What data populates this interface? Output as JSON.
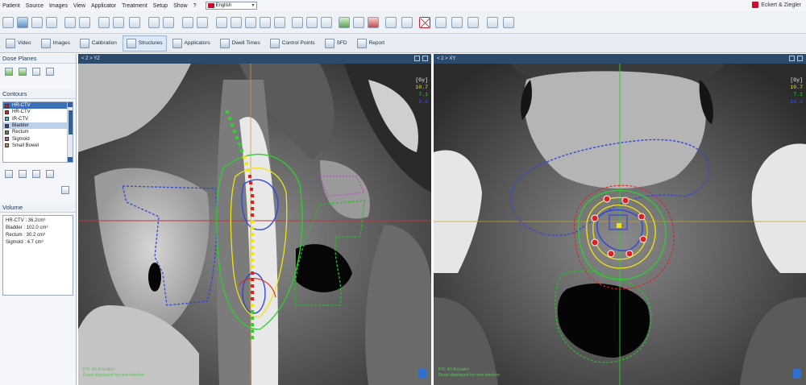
{
  "menu": [
    "Patient",
    "Source",
    "Images",
    "View",
    "Applicator",
    "Treatment",
    "Setup",
    "Show",
    "?"
  ],
  "language": "English",
  "brand": "Eckert & Ziegler",
  "steps": [
    {
      "label": "Video",
      "active": false
    },
    {
      "label": "Images",
      "active": false
    },
    {
      "label": "Calibration",
      "active": false
    },
    {
      "label": "Structures",
      "active": true
    },
    {
      "label": "Applicators",
      "active": false
    },
    {
      "label": "Dwell Times",
      "active": false
    },
    {
      "label": "Control Points",
      "active": false
    },
    {
      "label": "SFD",
      "active": false
    },
    {
      "label": "Report",
      "active": false
    }
  ],
  "dose_planes": {
    "title": "Dose Planes"
  },
  "contours": {
    "title": "Contours",
    "items": [
      {
        "label": "HR-CTV",
        "color": "#e02020",
        "state": "selected"
      },
      {
        "label": "HR-CTV",
        "color": "#e02020",
        "state": ""
      },
      {
        "label": "IR-CTV",
        "color": "#20c8d8",
        "state": ""
      },
      {
        "label": "Bladder",
        "color": "#2a3fd0",
        "state": "highlight"
      },
      {
        "label": "Rectum",
        "color": "#20b020",
        "state": ""
      },
      {
        "label": "Sigmoid",
        "color": "#e040e0",
        "state": ""
      },
      {
        "label": "Small Bowel",
        "color": "#f08020",
        "state": ""
      }
    ]
  },
  "volume": {
    "title": "Volume",
    "rows": [
      "HR-CTV : 36.2cm³",
      "Bladder : 102.0 cm³",
      "Rectum : 30.2 cm³",
      "Sigmoid : 4.7 cm³"
    ]
  },
  "viewports": [
    {
      "header": "< 2 > YZ",
      "legend_title": "[Gy]",
      "legend": [
        {
          "value": "10.7",
          "color": "#f2e313"
        },
        {
          "value": "7.1",
          "color": "#33d133"
        },
        {
          "value": "3.6",
          "color": "#3355ff"
        }
      ],
      "footer": [
        "P.0: 40 Actuator",
        "Dose displayed for one fraction"
      ]
    },
    {
      "header": "< 2 > XY",
      "legend_title": "[Gy]",
      "legend": [
        {
          "value": "10.7",
          "color": "#f2e313"
        },
        {
          "value": "7.1",
          "color": "#33d133"
        },
        {
          "value": "14.3",
          "color": "#3355ff"
        }
      ],
      "footer": [
        "P.0: 40 Actuator",
        "Dose displayed for one fraction"
      ]
    }
  ]
}
